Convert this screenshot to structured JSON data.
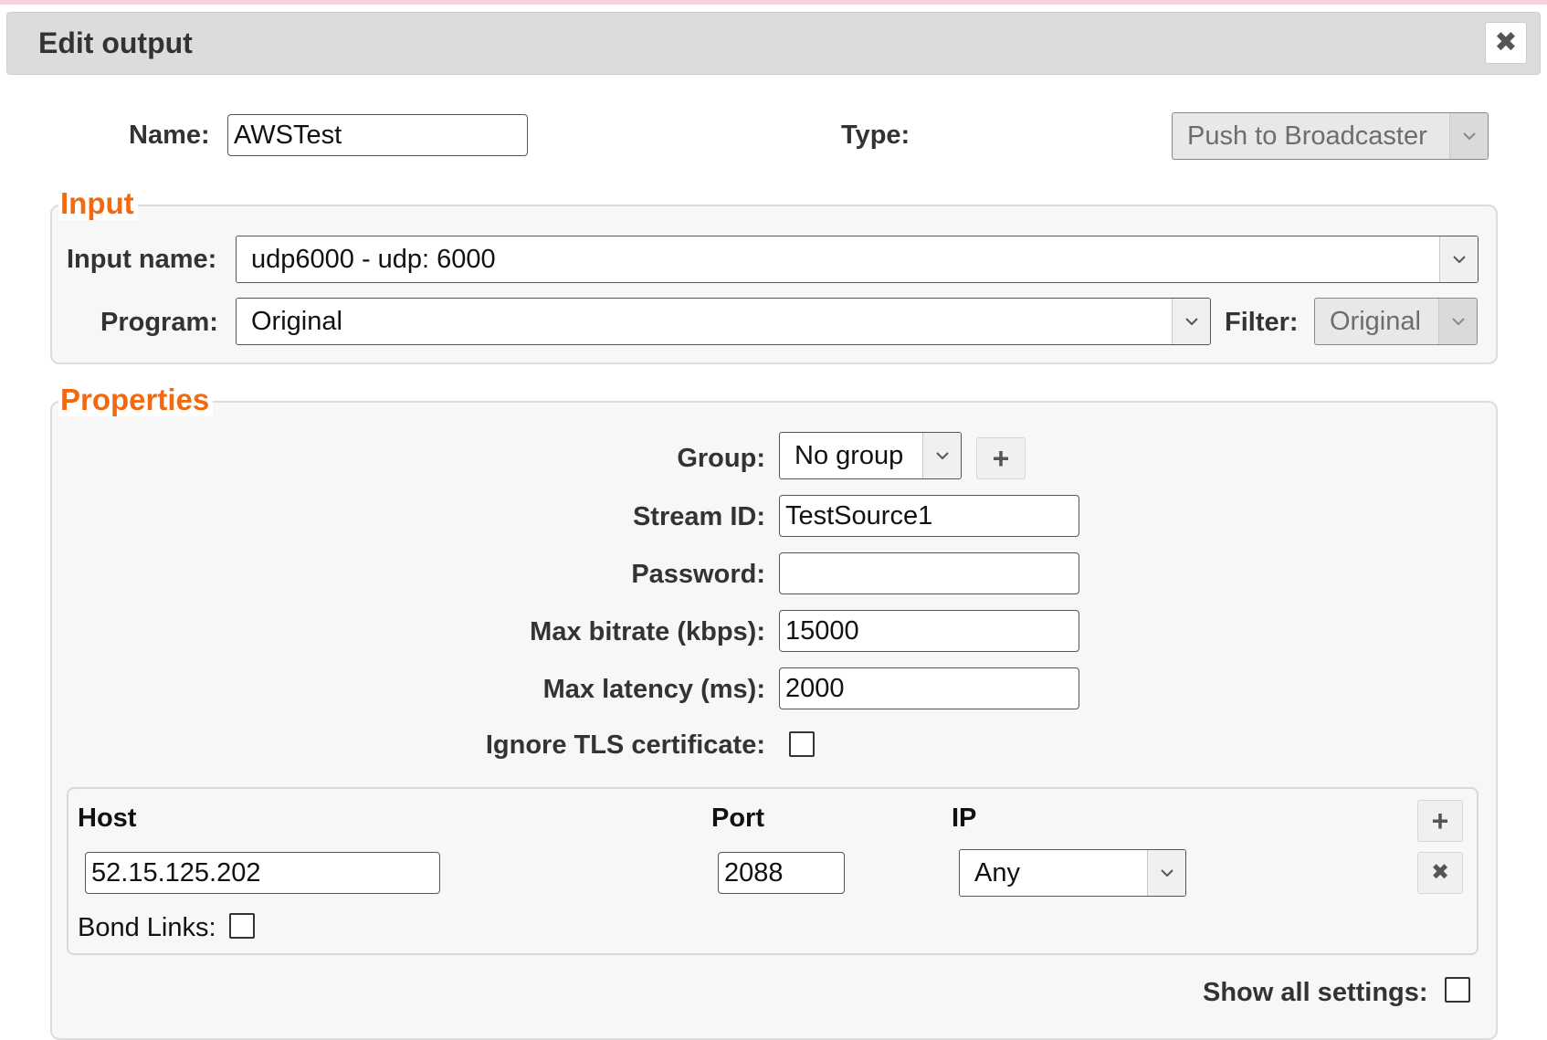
{
  "dialog": {
    "title": "Edit output",
    "close_icon": "close-icon"
  },
  "general": {
    "name_label": "Name:",
    "name_value": "AWSTest",
    "type_label": "Type:",
    "type_value": "Push to Broadcaster"
  },
  "input_section": {
    "legend": "Input",
    "input_name_label": "Input name:",
    "input_name_value": "udp6000 - udp: 6000",
    "program_label": "Program:",
    "program_value": "Original",
    "filter_label": "Filter:",
    "filter_value": "Original"
  },
  "properties_section": {
    "legend": "Properties",
    "group_label": "Group:",
    "group_value": "No group",
    "add_group_icon": "plus-icon",
    "stream_id_label": "Stream ID:",
    "stream_id_value": "TestSource1",
    "password_label": "Password:",
    "password_value": "",
    "max_bitrate_label": "Max bitrate (kbps):",
    "max_bitrate_value": "15000",
    "max_latency_label": "Max latency (ms):",
    "max_latency_value": "2000",
    "ignore_tls_label": "Ignore TLS certificate:",
    "ignore_tls_checked": false
  },
  "hosts": {
    "columns": {
      "host": "Host",
      "port": "Port",
      "ip": "IP"
    },
    "rows": [
      {
        "host": "52.15.125.202",
        "port": "2088",
        "ip": "Any"
      }
    ],
    "bond_links_label": "Bond Links:",
    "bond_links_checked": false,
    "add_row_icon": "plus-icon",
    "remove_row_icon": "close-icon"
  },
  "footer": {
    "show_all_settings_label": "Show all settings:",
    "show_all_settings_checked": false
  },
  "colors": {
    "accent_legend": "#f26a10",
    "titlebar_bg": "#dcdcdc",
    "fieldset_bg": "#f7f7f7"
  }
}
